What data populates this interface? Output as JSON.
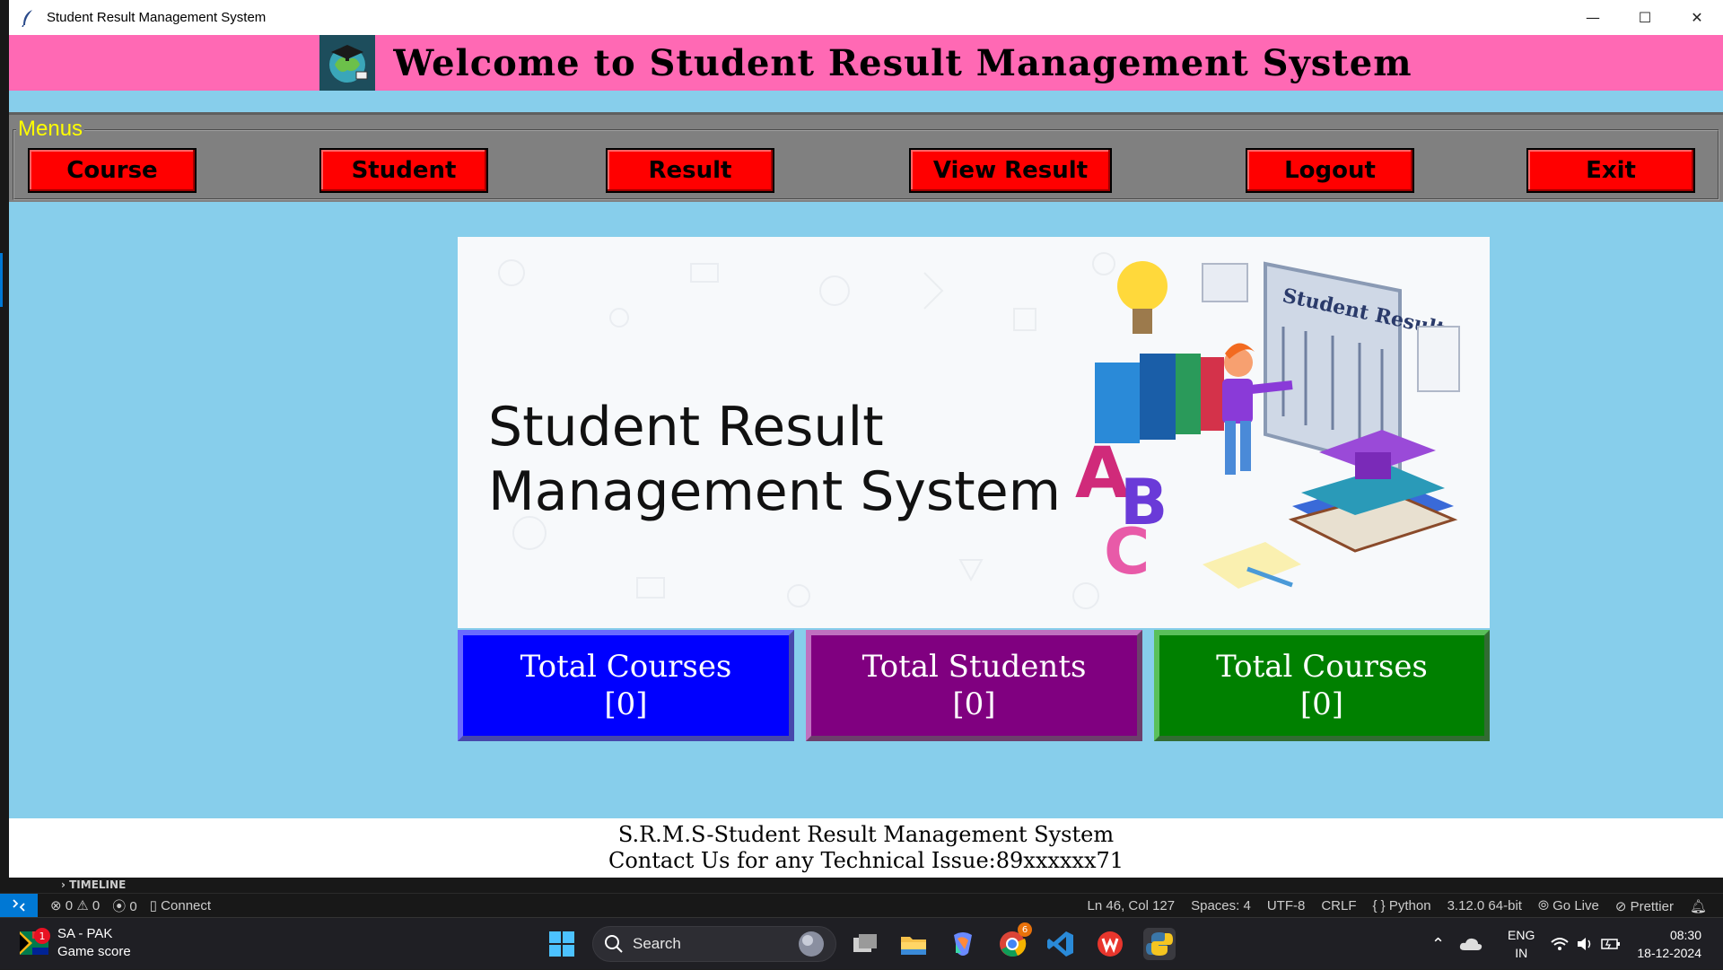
{
  "window": {
    "title": "Student Result Management System",
    "controls": {
      "minimize": "—",
      "maximize": "☐",
      "close": "✕"
    }
  },
  "header": {
    "title": "Welcome to Student Result Management System"
  },
  "menus": {
    "label": "Menus",
    "buttons": [
      "Course",
      "Student",
      "Result",
      "View Result",
      "Logout",
      "Exit"
    ]
  },
  "banner": {
    "title_line1": "Student Result",
    "title_line2": "Management System",
    "board_text": "Student Result",
    "letters": [
      "A",
      "B",
      "C"
    ]
  },
  "stats": [
    {
      "label": "Total Courses",
      "value": "[0]",
      "color": "#0000ff"
    },
    {
      "label": "Total Students",
      "value": "[0]",
      "color": "#800080"
    },
    {
      "label": "Total Courses",
      "value": "[0]",
      "color": "#008000"
    }
  ],
  "footer": {
    "line1": "S.R.M.S-Student Result Management System",
    "line2": "Contact Us for any Technical Issue:89xxxxxx71"
  },
  "vscode": {
    "timeline": "TIMELINE",
    "status": {
      "errors": "0",
      "warnings": "0",
      "ports": "0",
      "connect": "Connect",
      "position": "Ln 46, Col 127",
      "spaces": "Spaces: 4",
      "encoding": "UTF-8",
      "eol": "CRLF",
      "language": "Python",
      "interpreter": "3.12.0 64-bit",
      "golive": "Go Live",
      "prettier": "Prettier"
    }
  },
  "taskbar": {
    "weather_title": "SA - PAK",
    "weather_sub": "Game score",
    "weather_badge": "1",
    "search_placeholder": "Search",
    "chrome_badge": "6",
    "lang_top": "ENG",
    "lang_bottom": "IN",
    "time": "08:30",
    "date": "18-12-2024"
  }
}
